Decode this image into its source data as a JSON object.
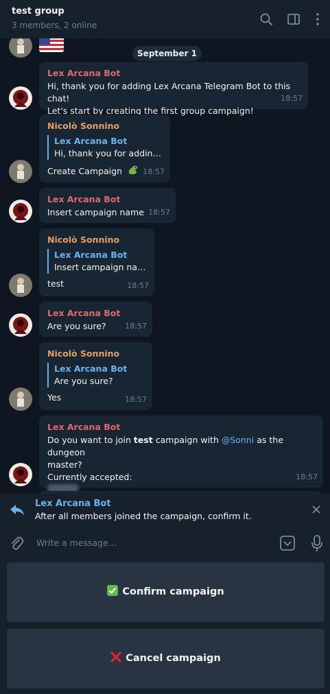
{
  "header": {
    "title": "test group",
    "subtitle": "3 members, 2 online",
    "icons": [
      "search-icon",
      "sidebar-toggle-icon",
      "more-vertical-icon"
    ]
  },
  "chat": {
    "date_separator": "September 1",
    "messages": [
      {
        "sender": "Lex Arcana Bot",
        "line1": "Hi, thank you for adding Lex Arcana Telegram Bot to this chat!",
        "line2": "Let's start by creating the first group campaign!",
        "time": "18:57"
      },
      {
        "sender": "Nicolò Sonnino",
        "reply_name": "Lex Arcana Bot",
        "reply_text": "Hi, thank you for adding ...",
        "text": "Create Campaign",
        "emoji": "dragon-icon",
        "time": "18:57"
      },
      {
        "sender": "Lex Arcana Bot",
        "text": "Insert campaign name",
        "time": "18:57"
      },
      {
        "sender": "Nicolò Sonnino",
        "reply_name": "Lex Arcana Bot",
        "reply_text": "Insert campaign name",
        "text": "test",
        "time": "18:57"
      },
      {
        "sender": "Lex Arcana Bot",
        "text": "Are you sure?",
        "time": "18:57"
      },
      {
        "sender": "Nicolò Sonnino",
        "reply_name": "Lex Arcana Bot",
        "reply_text": "Are you sure?",
        "text": "Yes",
        "time": "18:57"
      },
      {
        "sender": "Lex Arcana Bot",
        "part1": "Do you want to join ",
        "bold": "test",
        "part2": " campaign with ",
        "mention": "@Sonni",
        "part3": " as the dungeon",
        "line2": "master?",
        "line3": "Currently accepted:",
        "time": "18:57"
      }
    ]
  },
  "reply_panel": {
    "name": "Lex Arcana Bot",
    "text": "After all members joined the campaign, confirm it."
  },
  "input": {
    "placeholder": "Write a message..."
  },
  "keyboard": {
    "confirm_label": "Confirm campaign",
    "cancel_label": "Cancel campaign"
  },
  "colors": {
    "bot_name": "#e4676b",
    "user_name": "#e5a064",
    "accent": "#64b5ef",
    "bubble": "#182533",
    "background": "#0e1621"
  }
}
